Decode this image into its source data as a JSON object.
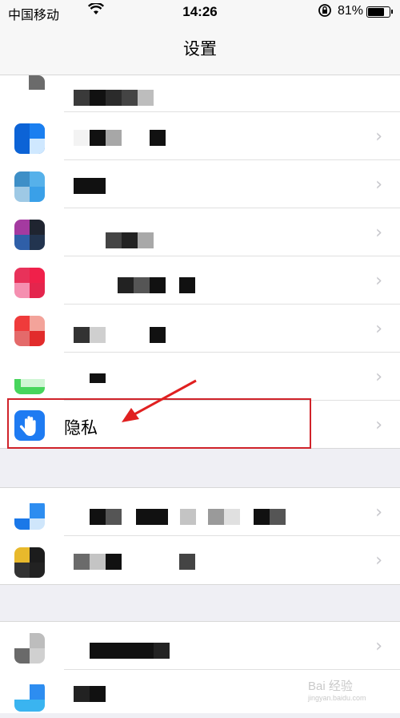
{
  "status_bar": {
    "carrier": "中国移动",
    "wifi_icon": "wifi-icon",
    "time": "14:26",
    "lock_icon": "orientation-lock-icon",
    "battery_percent": "81%",
    "battery_level": 0.81
  },
  "navbar": {
    "title": "设置"
  },
  "settings": {
    "privacy_label": "隐私",
    "privacy_icon": "hand-icon",
    "privacy_color": "#1e7bf2",
    "highlight_color": "#d0232a",
    "chevron": "›"
  },
  "watermark": {
    "text": "Bai 经验",
    "sub": "jingyan.baidu.com"
  }
}
